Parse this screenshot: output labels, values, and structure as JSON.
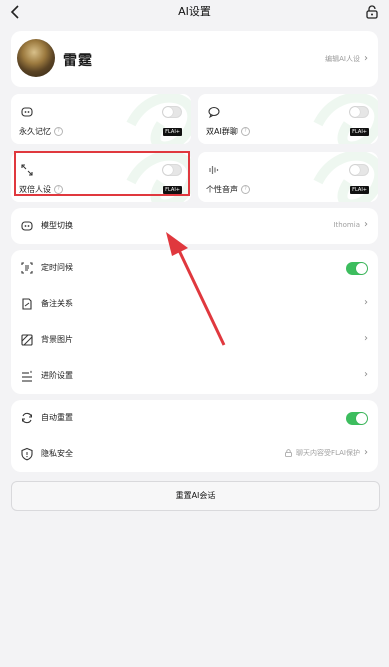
{
  "header": {
    "title": "AI设置",
    "back_icon": "chevron-left-icon",
    "right_icon": "lock-icon"
  },
  "profile": {
    "name": "雷霆",
    "edit_label": "编辑AI人设"
  },
  "tiles": [
    {
      "label": "永久记忆",
      "icon": "memory-icon",
      "badge": "FLAI+",
      "toggle_on": false
    },
    {
      "label": "双AI群聊",
      "icon": "chat-icon",
      "badge": "FLAI+",
      "toggle_on": false
    },
    {
      "label": "双倍人设",
      "icon": "expand-icon",
      "badge": "FLAI+",
      "toggle_on": false
    },
    {
      "label": "个性音声",
      "icon": "voice-icon",
      "badge": "FLAI+",
      "toggle_on": false
    }
  ],
  "model_row": {
    "label": "模型切换",
    "value": "Ithomia"
  },
  "settings": [
    {
      "label": "定时问候",
      "type": "toggle",
      "on": true
    },
    {
      "label": "备注关系",
      "type": "link"
    },
    {
      "label": "背景图片",
      "type": "link"
    },
    {
      "label": "进阶设置",
      "type": "link"
    }
  ],
  "privacy": {
    "auto_reset": {
      "label": "自动重置",
      "on": true
    },
    "security": {
      "label": "隐私安全",
      "note": "聊天内容受FLAI保护"
    }
  },
  "reset_button": "重置AI会话",
  "colors": {
    "accent_green": "#3dbd5e",
    "highlight_red": "#e0383e"
  }
}
